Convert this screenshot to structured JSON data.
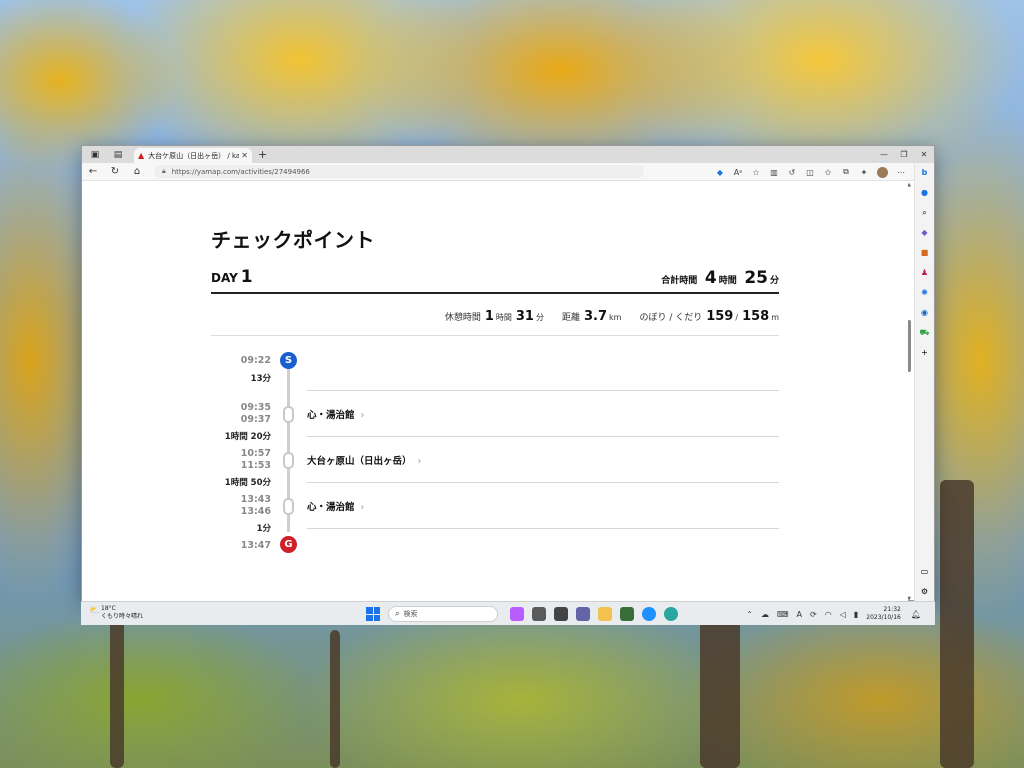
{
  "browser": {
    "tab_title": "大台ケ原山（日出ヶ岳） / kazuhi",
    "url": "https://yamap.com/activities/27494966"
  },
  "page": {
    "heading": "チェックポイント",
    "day_prefix": "DAY",
    "day_number": "1",
    "total_label": "合計時間",
    "total_hours": "4",
    "total_hours_unit": "時間",
    "total_minutes": "25",
    "total_minutes_unit": "分",
    "stats": {
      "rest_label": "休憩時間",
      "rest_hours": "1",
      "rest_hours_unit": "時間",
      "rest_minutes": "31",
      "rest_minutes_unit": "分",
      "distance_label": "距離",
      "distance_value": "3.7",
      "distance_unit": "km",
      "updown_label": "のぼり / くだり",
      "up_value": "159",
      "separator": "/",
      "down_value": "158",
      "updown_unit": "m"
    }
  },
  "timeline": {
    "start_marker": "S",
    "goal_marker": "G",
    "start_time": "09:22",
    "goal_time": "13:47",
    "durations": [
      "13分",
      "1時間 20分",
      "1時間 50分",
      "1分"
    ],
    "checkpoints": [
      {
        "arrive": "09:35",
        "depart": "09:37",
        "name": "心・湯治館"
      },
      {
        "arrive": "10:57",
        "depart": "11:53",
        "name": "大台ヶ原山（日出ヶ岳）"
      },
      {
        "arrive": "13:43",
        "depart": "13:46",
        "name": "心・湯治館"
      }
    ]
  },
  "taskbar": {
    "weather_temp": "18°C",
    "weather_desc": "くもり時々晴れ",
    "search_placeholder": "検索",
    "clock_time": "21:32",
    "clock_date": "2023/10/16"
  },
  "colors": {
    "start_marker": "#1a5fcf",
    "goal_marker": "#d0202a",
    "accent": "#111111"
  },
  "icons": {
    "tab_favicon": "yamap-logo-icon",
    "back": "back-arrow-icon",
    "refresh": "refresh-icon",
    "home": "home-icon"
  }
}
